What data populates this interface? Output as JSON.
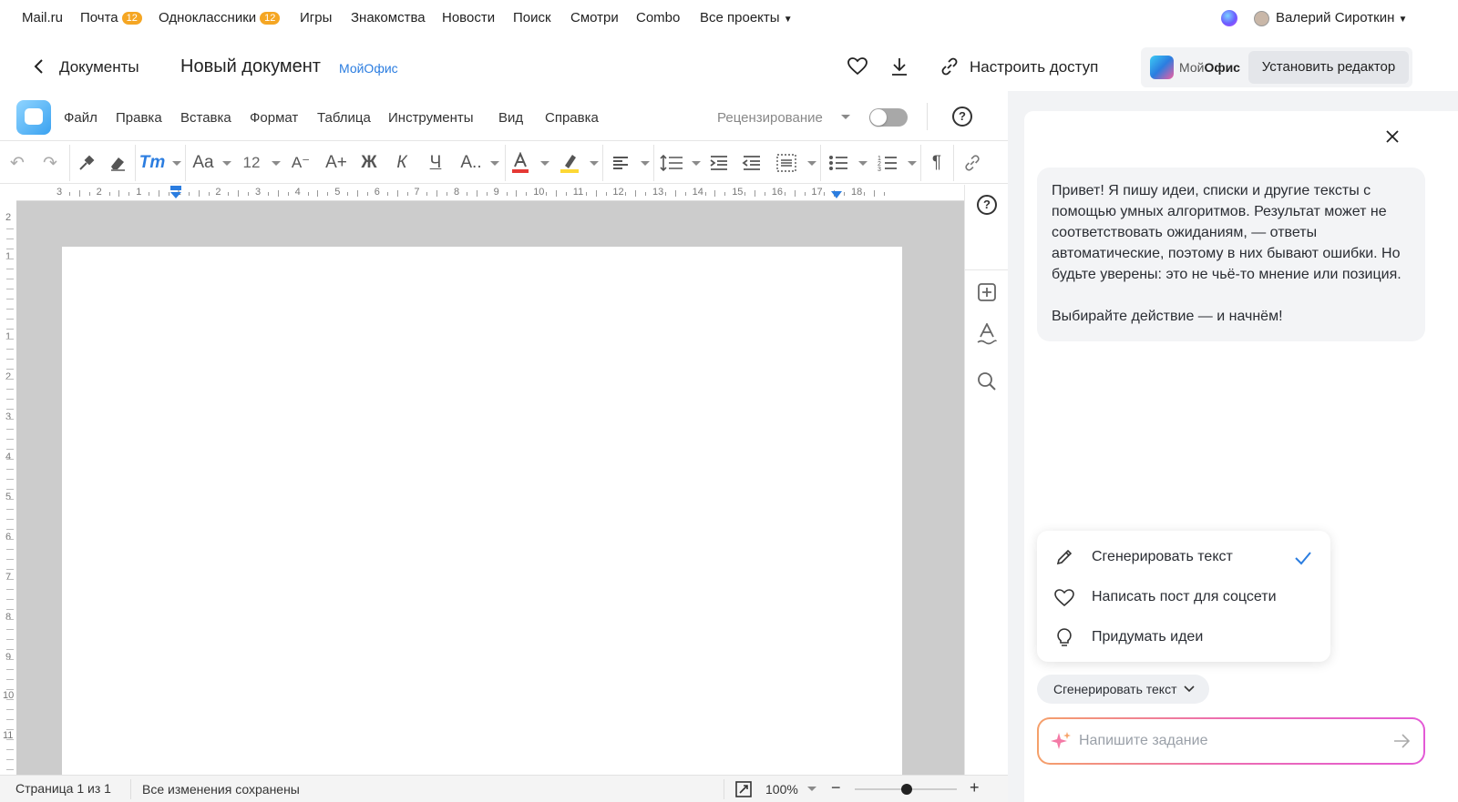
{
  "portal": {
    "links": [
      {
        "label": "Mail.ru"
      },
      {
        "label": "Почта",
        "badge": "12"
      },
      {
        "label": "Одноклассники",
        "badge": "12"
      },
      {
        "label": "Игры"
      },
      {
        "label": "Знакомства"
      },
      {
        "label": "Новости"
      },
      {
        "label": "Поиск"
      },
      {
        "label": "Смотри"
      },
      {
        "label": "Combo"
      },
      {
        "label": "Все проекты"
      }
    ],
    "user_name": "Валерий Сироткин"
  },
  "header": {
    "back_label": "Документы",
    "doc_title": "Новый документ",
    "brand_tag": "МойОфис",
    "share_label": "Настроить доступ",
    "office_logo_text_a": "Мой",
    "office_logo_text_b": "Офис",
    "install_label": "Установить редактор"
  },
  "menu": {
    "items": [
      "Файл",
      "Правка",
      "Вставка",
      "Формат",
      "Таблица",
      "Инструменты",
      "Вид",
      "Справка"
    ],
    "review_label": "Рецензирование"
  },
  "toolbar": {
    "font_size": "12"
  },
  "ruler": {
    "h_labels": [
      "3",
      "2",
      "1",
      "1",
      "2",
      "3",
      "4",
      "5",
      "6",
      "7",
      "8",
      "9",
      "10",
      "11",
      "12",
      "13",
      "14",
      "15",
      "16",
      "17",
      "18"
    ],
    "v_labels": [
      "2",
      "1",
      "1",
      "2",
      "3",
      "4",
      "5",
      "6",
      "7",
      "8",
      "9",
      "10",
      "11"
    ]
  },
  "status": {
    "page_info": "Страница 1 из 1",
    "save_state": "Все изменения сохранены",
    "zoom": "100%"
  },
  "assistant": {
    "greeting_p1": "Привет! Я пишу идеи, списки и другие тексты с помощью умных алгоритмов. Результат может не соответствовать ожиданиям, — ответы автоматические, поэтому в них бывают ошибки. Но будьте уверены: это не чьё-то мнение или позиция.",
    "greeting_p2": "Выбирайте действие — и начнём!",
    "actions": [
      {
        "label": "Сгенерировать текст",
        "icon": "pencil-icon",
        "selected": true
      },
      {
        "label": "Написать пост для соцсети",
        "icon": "heart-icon",
        "selected": false
      },
      {
        "label": "Придумать идеи",
        "icon": "lightbulb-icon",
        "selected": false
      }
    ],
    "current_action": "Сгенерировать текст",
    "input_placeholder": "Напишите задание"
  },
  "colors": {
    "accent_blue": "#2b7de0",
    "badge_orange": "#f5a623",
    "font_color_red": "#e53935",
    "highlight_yellow": "#fdd835"
  }
}
